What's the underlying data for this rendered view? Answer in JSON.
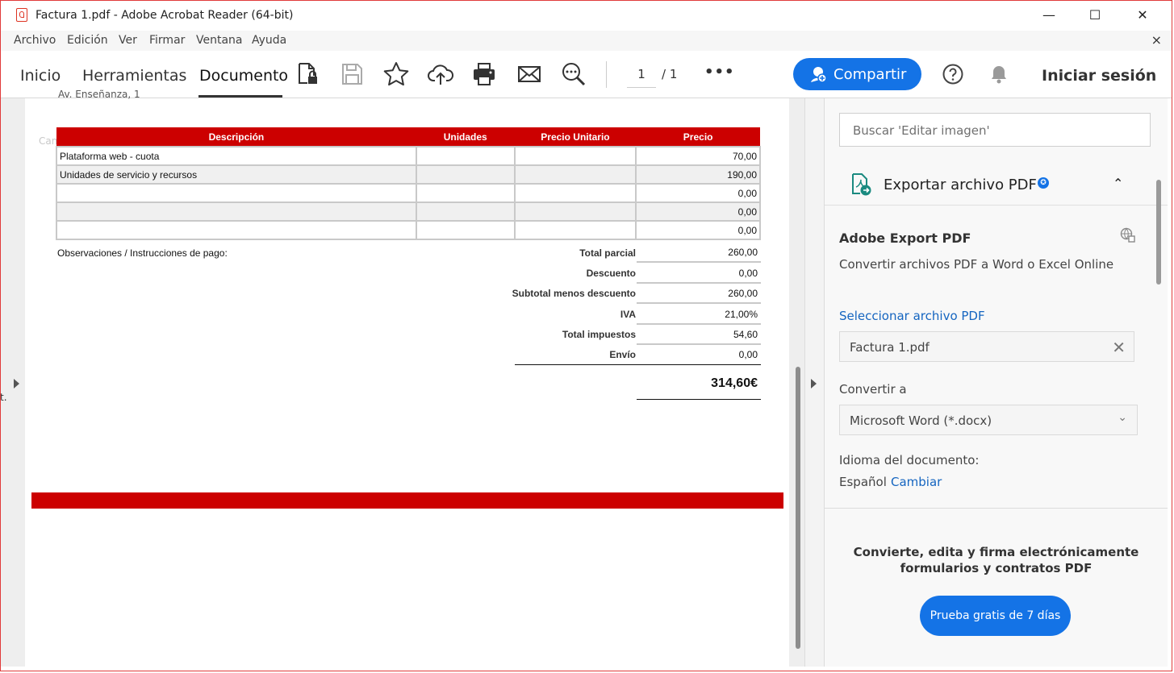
{
  "window": {
    "title": "Factura 1.pdf - Adobe Acrobat Reader (64-bit)",
    "minimize": "—",
    "maximize": "☐",
    "close": "✕"
  },
  "menu": {
    "items": [
      "Archivo",
      "Edición",
      "Ver",
      "Firmar",
      "Ventana",
      "Ayuda"
    ],
    "close": "×"
  },
  "toolbar": {
    "tabs": [
      "Inicio",
      "Herramientas",
      "Documento"
    ],
    "active_tab": "Documento",
    "page_current": "1",
    "page_total": "/ 1",
    "more": "•••",
    "share_label": "Compartir",
    "signin_label": "Iniciar sesión",
    "icons": [
      "lock-file-icon",
      "save-icon",
      "star-icon",
      "cloud-upload-icon",
      "print-icon",
      "mail-icon",
      "zoom-icon",
      "help-icon",
      "bell-icon"
    ]
  },
  "document": {
    "ghost_text": "Cancelar",
    "cut_text": "Av. Enseñanza, 1",
    "table": {
      "headers": [
        "Descripción",
        "Unidades",
        "Precio Unitario",
        "Precio"
      ],
      "rows": [
        [
          "Plataforma web - cuota",
          "",
          "",
          "70,00"
        ],
        [
          "Unidades de servicio y recursos",
          "",
          "",
          "190,00"
        ],
        [
          "",
          "",
          "",
          "0,00"
        ],
        [
          "",
          "",
          "",
          "0,00"
        ],
        [
          "",
          "",
          "",
          "0,00"
        ]
      ]
    },
    "observations": "Observaciones / Instrucciones de pago:",
    "totals": [
      {
        "label": "Total parcial",
        "value": "260,00"
      },
      {
        "label": "Descuento",
        "value": "0,00"
      },
      {
        "label": "Subtotal menos descuento",
        "value": "260,00"
      },
      {
        "label": "IVA",
        "value": "21,00%"
      },
      {
        "label": "Total impuestos",
        "value": "54,60"
      },
      {
        "label": "Envío",
        "value": "0,00"
      }
    ],
    "grand_total": "314,60€",
    "accent_color": "#cc0000"
  },
  "edge_text": "t.",
  "right_pane": {
    "search_placeholder": "Buscar 'Editar imagen'",
    "export_title": "Exportar archivo PDF",
    "export_badge": "✪",
    "collapse": "⌃",
    "service_title": "Adobe Export PDF",
    "service_desc": "Convertir archivos PDF a Word o Excel Online",
    "select_link": "Seleccionar archivo PDF",
    "selected_file": "Factura 1.pdf",
    "clear": "✕",
    "convert_label": "Convertir a",
    "convert_value": "Microsoft Word (*.docx)",
    "dropdown": "⌄",
    "language_label": "Idioma del documento:",
    "language_value": "Español",
    "language_change": "Cambiar",
    "promo_text": "Convierte, edita y firma electrónicamente formularios y contratos PDF",
    "trial_button": "Prueba gratis de 7 días",
    "brand_color": "#1473e6"
  }
}
